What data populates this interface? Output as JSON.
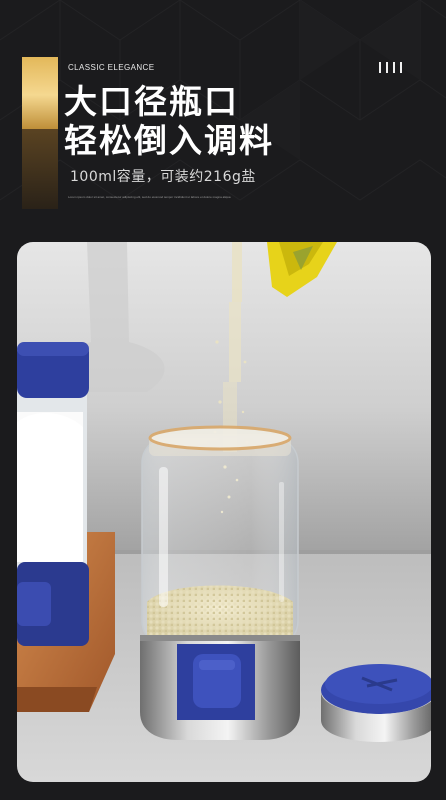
{
  "header": {
    "brand": "CLASSIC ELEGANCE",
    "title_line1": "大口径瓶口",
    "title_line2": "轻松倒入调料",
    "subtitle": "100ml容量，可装约216g盐",
    "fine_print": "Lorem ipsum dolor sit amet, consectetur adipiscing elit, sed do eiusmod tempor incididunt ut labore et dolore magna aliqua"
  },
  "icons": [
    "menu-icon"
  ],
  "colors": {
    "background": "#1b1b1d",
    "gold_accent": "#d4a64a",
    "lid_blue": "#2e3f9e",
    "text_white": "#ffffff"
  }
}
